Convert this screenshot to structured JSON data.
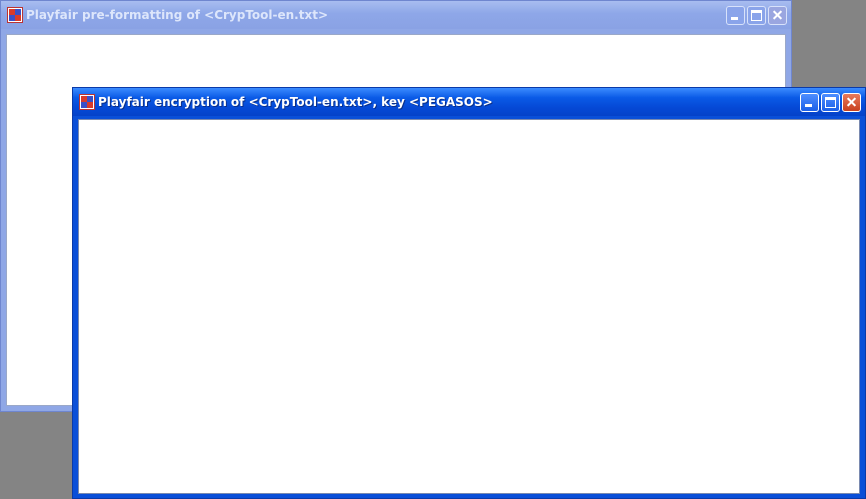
{
  "windows": {
    "back": {
      "title": "Playfair pre-formatting of <CrypTool-en.txt>",
      "icon": "cryptool-app-icon",
      "controls": [
        "minimize-icon",
        "maximize-icon",
        "close-icon"
      ]
    },
    "front": {
      "title": "Playfair encryption of <CrypTool-en.txt>, key <PEGASOS>",
      "icon": "cryptool-app-icon",
      "controls": [
        "minimize-icon",
        "maximize-icon",
        "close-icon"
      ]
    }
  },
  "colors": {
    "desktop": "#848484",
    "active_title": "#0a5ae6",
    "inactive_title": "#8ea7e8",
    "close_button": "#c8401e"
  }
}
